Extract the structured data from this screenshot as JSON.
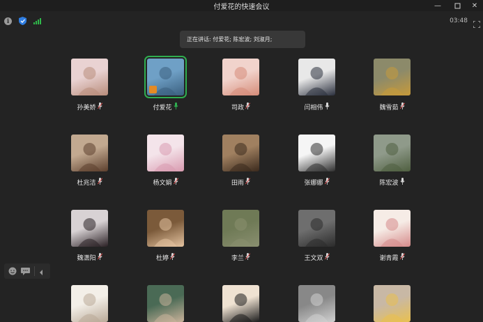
{
  "window": {
    "title": "付爱花的快速会议",
    "controls": [
      "minimize-icon",
      "maximize-icon",
      "close-icon"
    ]
  },
  "status": {
    "timer": "03:48",
    "icons": [
      "info-icon",
      "shield-icon",
      "signal-icon",
      "fullscreen-icon"
    ],
    "signal_color": "#2fb84a"
  },
  "speaking": {
    "text": "正在讲话: 付爱花; 陈宏波; 刘淑月;"
  },
  "participants": [
    {
      "name": "孙美娇",
      "mic": "muted",
      "active": false,
      "colors": [
        "#e9d2d2",
        "#b88c7a"
      ]
    },
    {
      "name": "付爱花",
      "mic": "speaking",
      "active": true,
      "colors": [
        "#6fa0c6",
        "#3a5f7e"
      ]
    },
    {
      "name": "司政",
      "mic": "muted",
      "active": false,
      "colors": [
        "#f1d3cc",
        "#d58b78"
      ]
    },
    {
      "name": "闫相伟",
      "mic": "on",
      "active": false,
      "colors": [
        "#e8e8e8",
        "#2a2f3d"
      ]
    },
    {
      "name": "魏雪茹",
      "mic": "muted",
      "active": false,
      "colors": [
        "#8c8a6a",
        "#c79a3a"
      ]
    },
    {
      "name": "杜兆洁",
      "mic": "muted",
      "active": false,
      "colors": [
        "#c2a990",
        "#5c3f2d"
      ]
    },
    {
      "name": "杨文娟",
      "mic": "muted",
      "active": false,
      "colors": [
        "#f4e4ea",
        "#d99bb0"
      ]
    },
    {
      "name": "田雨",
      "mic": "muted",
      "active": false,
      "colors": [
        "#a08060",
        "#3b2a1d"
      ]
    },
    {
      "name": "张娜娜",
      "mic": "muted",
      "active": false,
      "colors": [
        "#f5f5f5",
        "#2f2f2f"
      ]
    },
    {
      "name": "陈宏波",
      "mic": "on",
      "active": false,
      "colors": [
        "#8f9a8a",
        "#4f5f40"
      ]
    },
    {
      "name": "魏潇阳",
      "mic": "muted",
      "active": false,
      "colors": [
        "#d8d2d4",
        "#2a2024"
      ]
    },
    {
      "name": "杜婷",
      "mic": "muted",
      "active": false,
      "colors": [
        "#7b5a3a",
        "#e4c3a0"
      ]
    },
    {
      "name": "李兰",
      "mic": "muted",
      "active": false,
      "colors": [
        "#6f7a56",
        "#8a8f70"
      ]
    },
    {
      "name": "王文双",
      "mic": "muted",
      "active": false,
      "colors": [
        "#6e6e6e",
        "#2b2b2b"
      ]
    },
    {
      "name": "谢青霞",
      "mic": "muted",
      "active": false,
      "colors": [
        "#f6ece6",
        "#d58a8a"
      ]
    },
    {
      "name": "",
      "mic": "none",
      "active": false,
      "colors": [
        "#f3efe8",
        "#b9a997"
      ]
    },
    {
      "name": "",
      "mic": "none",
      "active": false,
      "colors": [
        "#4a6a55",
        "#c9b29a"
      ]
    },
    {
      "name": "",
      "mic": "none",
      "active": false,
      "colors": [
        "#efe2d2",
        "#1c1c1c"
      ]
    },
    {
      "name": "",
      "mic": "none",
      "active": false,
      "colors": [
        "#888888",
        "#d0d0d0"
      ]
    },
    {
      "name": "",
      "mic": "none",
      "active": false,
      "colors": [
        "#c8b8a5",
        "#e9c04f"
      ]
    }
  ],
  "bottom_tools": [
    "emoji-icon",
    "chat-icon",
    "collapse-icon"
  ]
}
